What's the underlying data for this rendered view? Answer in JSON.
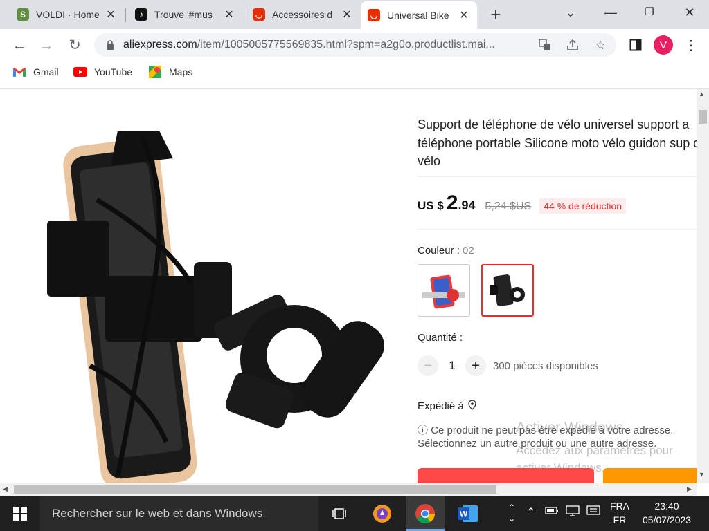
{
  "browser": {
    "tabs": [
      {
        "title": "VOLDI · Home",
        "favicon_color": "#5e8e3e",
        "favicon_glyph": "S",
        "active": false
      },
      {
        "title": "Trouve '#mus",
        "favicon_color": "#111111",
        "favicon_glyph": "♪",
        "active": false
      },
      {
        "title": "Accessoires d",
        "favicon_color": "#e62e04",
        "favicon_glyph": "◡",
        "active": false
      },
      {
        "title": "Universal Bike",
        "favicon_color": "#e62e04",
        "favicon_glyph": "◡",
        "active": true
      }
    ],
    "new_tab_label": "+",
    "url_domain": "aliexpress.com",
    "url_path": "/item/1005005775569835.html?spm=a2g0o.productlist.mai...",
    "profile_initial": "V",
    "bookmarks": [
      {
        "label": "Gmail",
        "icon": "gmail-icon"
      },
      {
        "label": "YouTube",
        "icon": "youtube-icon"
      },
      {
        "label": "Maps",
        "icon": "maps-icon"
      }
    ]
  },
  "product": {
    "title": "Support de téléphone de vélo universel support a téléphone portable Silicone moto vélo guidon sup de vélo",
    "currency": "US $",
    "price_int": "2",
    "price_dec": ".94",
    "old_price": "5,24 $US",
    "discount": "44 % de réduction",
    "color_label": "Couleur :",
    "color_value": "02",
    "quantity_label": "Quantité :",
    "quantity_value": "1",
    "quantity_minus": "−",
    "quantity_plus": "+",
    "stock": "300 pièces disponibles",
    "ship_label": "Expédié à",
    "ship_note": "ⓘ Ce produit ne peut pas être expédié à votre adresse. Sélectionnez un autre produit ou une autre adresse."
  },
  "watermark": {
    "line1": "Activer Windows",
    "line2": "Accédez aux paramètres pour activer Windows."
  },
  "taskbar": {
    "search_placeholder": "Rechercher sur le web et dans Windows",
    "lang_top": "FRA",
    "lang_bottom": "FR",
    "time": "23:40",
    "date": "05/07/2023"
  },
  "colors": {
    "accent": "#e62e2e",
    "buy_button": "#ff4747",
    "cart_button": "#ff9700"
  }
}
